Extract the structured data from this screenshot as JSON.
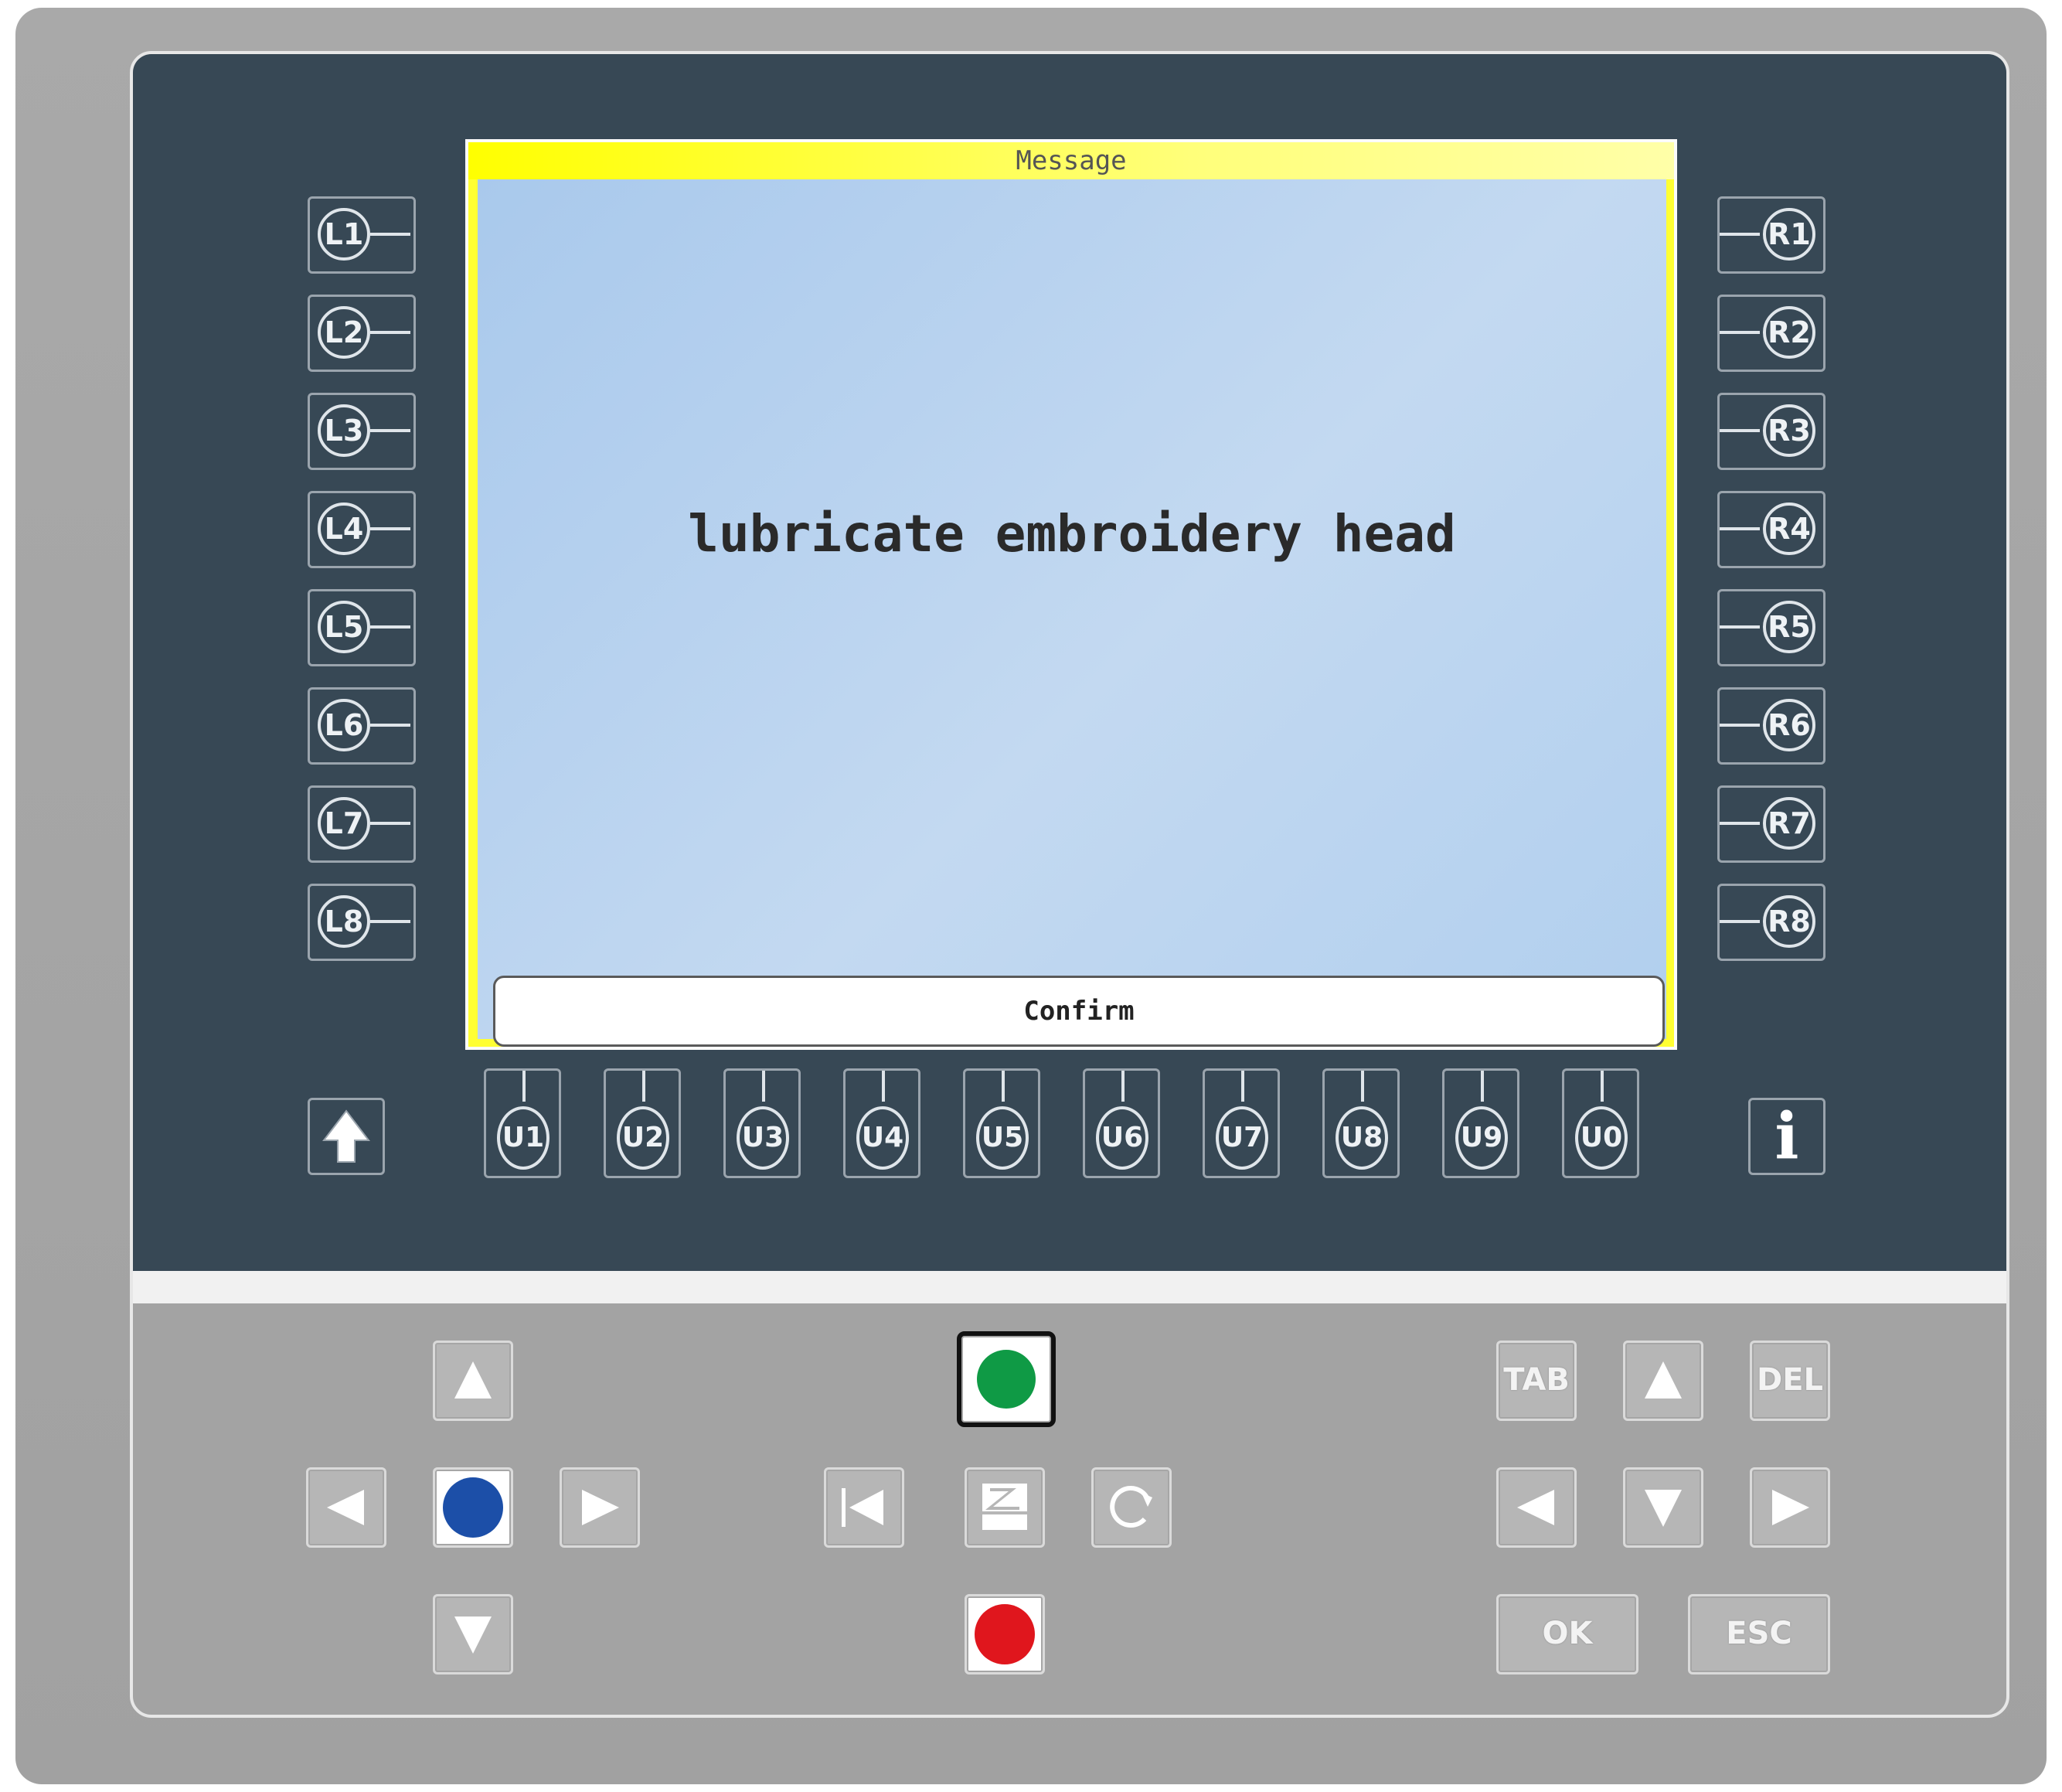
{
  "screen": {
    "title": "Message",
    "message": "lubricate embroidery head",
    "confirm_label": "Confirm"
  },
  "left_keys": [
    "L1",
    "L2",
    "L3",
    "L4",
    "L5",
    "L6",
    "L7",
    "L8"
  ],
  "right_keys": [
    "R1",
    "R2",
    "R3",
    "R4",
    "R5",
    "R6",
    "R7",
    "R8"
  ],
  "u_keys": [
    "U1",
    "U2",
    "U3",
    "U4",
    "U5",
    "U6",
    "U7",
    "U8",
    "U9",
    "U0"
  ],
  "keypad": {
    "tab_label": "TAB",
    "del_label": "DEL",
    "ok_label": "OK",
    "esc_label": "ESC",
    "info_label": "i",
    "start_icon": "green-start-icon",
    "stop_icon": "red-stop-icon",
    "blue_icon": "blue-dot-icon"
  },
  "colors": {
    "panel_dark": "#374855",
    "screen_frame": "#ffff33",
    "start_green": "#0f9a45",
    "stop_red": "#e0161d",
    "blue": "#1c4fa8"
  }
}
